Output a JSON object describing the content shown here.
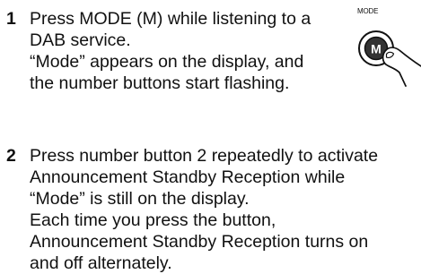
{
  "steps": [
    {
      "number": "1",
      "lines": [
        "Press MODE (M) while listening to a",
        "DAB service.",
        "“Mode” appears on the display, and",
        "the number buttons start flashing."
      ]
    },
    {
      "number": "2",
      "lines": [
        "Press number button 2 repeatedly to activate",
        "Announcement Standby Reception while",
        "“Mode” is still on the display.",
        "Each time you press the button,",
        "Announcement Standby Reception turns on",
        "and off alternately."
      ]
    }
  ],
  "illustration": {
    "caption": "MODE",
    "button_label": "M",
    "icon": "finger-pressing-button-icon"
  }
}
